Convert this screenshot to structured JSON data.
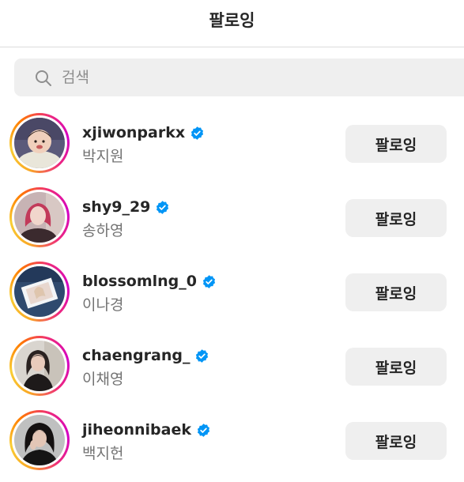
{
  "header": {
    "title": "팔로잉"
  },
  "search": {
    "placeholder": "검색",
    "value": ""
  },
  "following": [
    {
      "username": "xjiwonparkx",
      "full_name": "박지원",
      "verified": true,
      "button_label": "팔로잉"
    },
    {
      "username": "shy9_29",
      "full_name": "송하영",
      "verified": true,
      "button_label": "팔로잉"
    },
    {
      "username": "blossomlng_0",
      "full_name": "이나경",
      "verified": true,
      "button_label": "팔로잉"
    },
    {
      "username": "chaengrang_",
      "full_name": "이채영",
      "verified": true,
      "button_label": "팔로잉"
    },
    {
      "username": "jiheonnibaek",
      "full_name": "백지헌",
      "verified": true,
      "button_label": "팔로잉"
    }
  ],
  "colors": {
    "verified_badge": "#0095f6",
    "button_bg": "#efefef",
    "secondary_text": "#737373"
  }
}
